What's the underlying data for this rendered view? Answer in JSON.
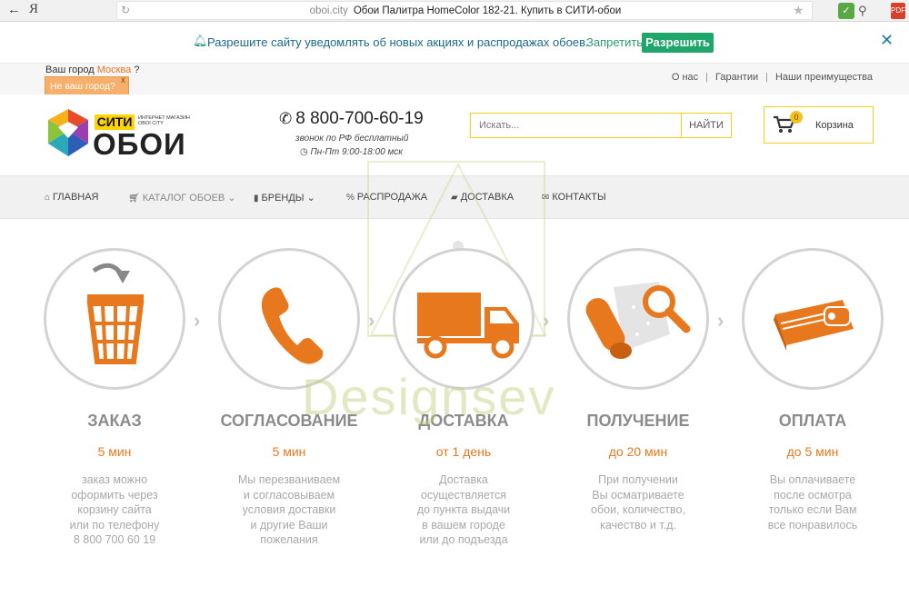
{
  "browser": {
    "back_glyph": "←",
    "yandex_glyph": "Я",
    "reload_glyph": "↻",
    "domain": "oboi.city",
    "tab_title": "Обои Палитра HomeColor 182-21. Купить в СИТИ-обои",
    "star_glyph": "★"
  },
  "notification": {
    "message": "Разрешите сайту уведомлять об новых акциях и распродажах обоев.",
    "deny": "Запретить",
    "allow": "Разрешить",
    "close": "✕"
  },
  "topline": {
    "city_prefix": "Ваш город",
    "city_name": "Москва",
    "city_suffix": "?",
    "not_your_city": "Не ваш город?",
    "not_city_close": "x",
    "links": [
      "О нас",
      "Гарантии",
      "Наши преимущества"
    ],
    "separator": "|"
  },
  "header": {
    "logo_city": "СИТИ",
    "logo_small_1": "ИНТЕРНЕТ МАГАЗИН",
    "logo_small_2": "OBOI CITY",
    "logo_oboi": "ОБОИ",
    "phone": "8 800-700-60-19",
    "phone_note": "звонок по РФ бесплатный",
    "hours": "Пн-Пт 9:00-18:00 мск",
    "search_placeholder": "Искать...",
    "search_button": "НАЙТИ",
    "cart_count": "0",
    "cart_label": "Корзина"
  },
  "nav": [
    {
      "label": "ГЛАВНАЯ"
    },
    {
      "label": "КАТАЛОГ ОБОЕВ"
    },
    {
      "label": "БРЕНДЫ"
    },
    {
      "label": "РАСПРОДАЖА"
    },
    {
      "label": "ДОСТАВКА"
    },
    {
      "label": "КОНТАКТЫ"
    }
  ],
  "steps": [
    {
      "title": "ЗАКАЗ",
      "time": "5 мин",
      "desc": [
        "заказ можно",
        "оформить через",
        "корзину сайта",
        "или по телефону",
        "8 800 700 60 19"
      ]
    },
    {
      "title": "СОГЛАСОВАНИЕ",
      "time": "5 мин",
      "desc": [
        "Мы перезваниваем",
        "и согласовываем",
        "условия доставки",
        "и другие Ваши",
        "пожелания"
      ]
    },
    {
      "title": "ДОСТАВКА",
      "time": "от 1 день",
      "desc": [
        "Доставка",
        "осуществляется",
        "до пункта выдачи",
        "в вашем городе",
        "или до подъезда"
      ]
    },
    {
      "title": "ПОЛУЧЕНИЕ",
      "time": "до 20 мин",
      "desc": [
        "При получении",
        "Вы осматриваете",
        "обои, количество,",
        "качество и т.д."
      ]
    },
    {
      "title": "ОПЛАТА",
      "time": "до 5 мин",
      "desc": [
        "Вы оплачиваете",
        "после осмотра",
        "только если Вам",
        "все понравилось"
      ]
    }
  ],
  "step_arrow": "›",
  "watermark": "Designsev",
  "colors": {
    "accent": "#e8781d",
    "yellow": "#f3cf1e",
    "green": "#1fa66a"
  }
}
